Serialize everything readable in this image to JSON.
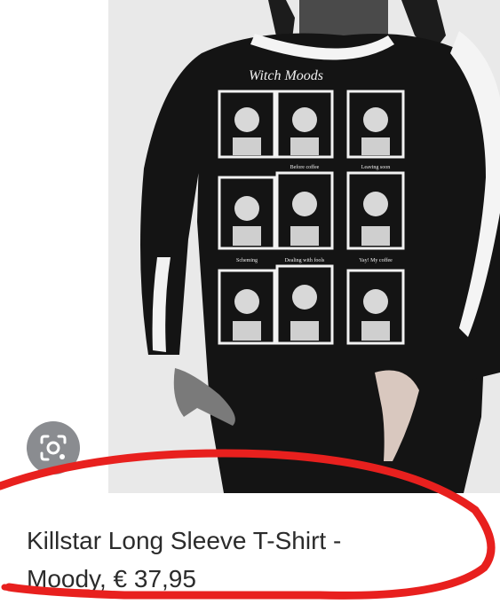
{
  "product": {
    "title_line1": "Killstar Long Sleeve T-Shirt -",
    "title_line2_name": "Moody,",
    "price": "€ 37,95"
  },
  "image": {
    "shirt_header_text": "Witch Moods",
    "panel_labels": [
      "Before coffee",
      "Leaving soon",
      "Scheming",
      "Dealing with fools",
      "Yay! My coffee"
    ]
  },
  "lens": {
    "icon": "camera-search-icon"
  },
  "annotation": {
    "color": "#e8201e"
  }
}
